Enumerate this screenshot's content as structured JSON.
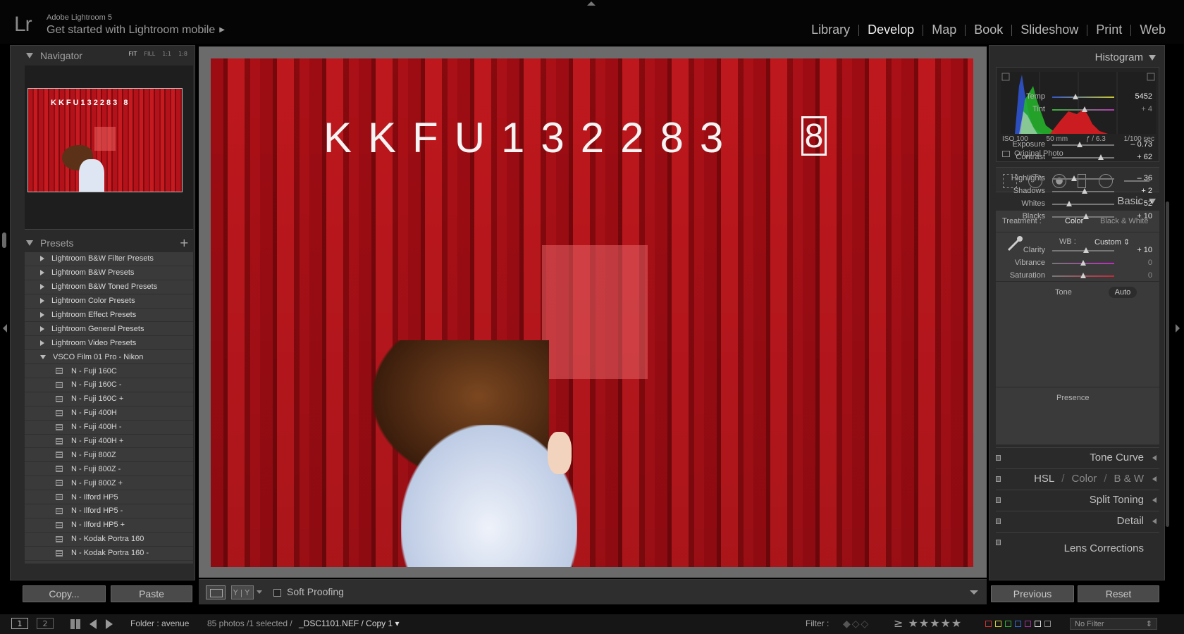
{
  "app": {
    "logo": "Lr",
    "version": "Adobe Lightroom 5",
    "mobile_link": "Get started with Lightroom mobile"
  },
  "modules": [
    {
      "label": "Library",
      "active": false
    },
    {
      "label": "Develop",
      "active": true
    },
    {
      "label": "Map",
      "active": false
    },
    {
      "label": "Book",
      "active": false
    },
    {
      "label": "Slideshow",
      "active": false
    },
    {
      "label": "Print",
      "active": false
    },
    {
      "label": "Web",
      "active": false
    }
  ],
  "navigator": {
    "title": "Navigator",
    "zoom_options": [
      "FIT",
      "FILL",
      "1:1",
      "1:8"
    ],
    "active_zoom": "FIT",
    "thumb_text": "KKFU132283 8"
  },
  "presets": {
    "title": "Presets",
    "add_icon": "plus-icon",
    "items": [
      {
        "label": "Lightroom B&W Filter Presets",
        "type": "folder"
      },
      {
        "label": "Lightroom B&W Presets",
        "type": "folder"
      },
      {
        "label": "Lightroom B&W Toned Presets",
        "type": "folder"
      },
      {
        "label": "Lightroom Color Presets",
        "type": "folder"
      },
      {
        "label": "Lightroom Effect Presets",
        "type": "folder"
      },
      {
        "label": "Lightroom General Presets",
        "type": "folder"
      },
      {
        "label": "Lightroom Video Presets",
        "type": "folder"
      },
      {
        "label": "VSCO Film 01 Pro - Nikon",
        "type": "folder-open"
      },
      {
        "label": "N - Fuji 160C",
        "type": "preset"
      },
      {
        "label": "N - Fuji 160C -",
        "type": "preset"
      },
      {
        "label": "N - Fuji 160C +",
        "type": "preset"
      },
      {
        "label": "N - Fuji 400H",
        "type": "preset"
      },
      {
        "label": "N - Fuji 400H -",
        "type": "preset"
      },
      {
        "label": "N - Fuji 400H +",
        "type": "preset"
      },
      {
        "label": "N - Fuji 800Z",
        "type": "preset"
      },
      {
        "label": "N - Fuji 800Z -",
        "type": "preset"
      },
      {
        "label": "N - Fuji 800Z +",
        "type": "preset"
      },
      {
        "label": "N - Ilford HP5",
        "type": "preset"
      },
      {
        "label": "N - Ilford HP5 -",
        "type": "preset"
      },
      {
        "label": "N - Ilford HP5 +",
        "type": "preset"
      },
      {
        "label": "N - Kodak Portra 160",
        "type": "preset"
      },
      {
        "label": "N - Kodak Portra 160 -",
        "type": "preset"
      },
      {
        "label": "N - Kodak Portra 160 +",
        "type": "preset"
      }
    ]
  },
  "left_buttons": {
    "copy": "Copy...",
    "paste": "Paste"
  },
  "photo": {
    "container_code": "KKFU132283",
    "container_check": "8"
  },
  "toolbar": {
    "soft_proofing": "Soft Proofing",
    "yy_label": "Y|Y"
  },
  "histogram": {
    "title": "Histogram",
    "iso": "ISO 100",
    "focal": "50 mm",
    "aperture": "ƒ / 6.3",
    "shutter": "1/100 sec",
    "original_photo": "Original Photo"
  },
  "basic": {
    "title": "Basic",
    "treatment_label": "Treatment :",
    "treatment_color": "Color",
    "treatment_bw": "Black & White",
    "wb_label": "WB :",
    "wb_value": "Custom",
    "tone_label": "Tone",
    "auto_label": "Auto",
    "presence_label": "Presence",
    "sliders": [
      {
        "label": "Temp",
        "value": "5452",
        "pos": 0.38,
        "dim": false
      },
      {
        "label": "Tint",
        "value": "+ 4",
        "pos": 0.52,
        "dim": true
      },
      {
        "label": "Exposure",
        "value": "– 0.73",
        "pos": 0.44,
        "dim": false
      },
      {
        "label": "Contrast",
        "value": "+ 62",
        "pos": 0.78,
        "dim": false
      },
      {
        "label": "Highlights",
        "value": "– 36",
        "pos": 0.35,
        "dim": false
      },
      {
        "label": "Shadows",
        "value": "+ 2",
        "pos": 0.52,
        "dim": false
      },
      {
        "label": "Whites",
        "value": "– 52",
        "pos": 0.27,
        "dim": false
      },
      {
        "label": "Blacks",
        "value": "+ 10",
        "pos": 0.55,
        "dim": false
      },
      {
        "label": "Clarity",
        "value": "+ 10",
        "pos": 0.55,
        "dim": false
      },
      {
        "label": "Vibrance",
        "value": "0",
        "pos": 0.5,
        "dim": true
      },
      {
        "label": "Saturation",
        "value": "0",
        "pos": 0.5,
        "dim": true
      }
    ]
  },
  "collapsed_panels": {
    "tone_curve": "Tone Curve",
    "hsl": "HSL",
    "color": "Color",
    "bw": "B & W",
    "split_toning": "Split Toning",
    "detail": "Detail",
    "lens": "Lens Corrections"
  },
  "right_buttons": {
    "previous": "Previous",
    "reset": "Reset"
  },
  "filmstrip": {
    "view1": "1",
    "view2": "2",
    "folder": "Folder : avenue",
    "count": "85 photos /1 selected /",
    "file": "_DSC1101.NEF / Copy 1",
    "filter_label": "Filter :",
    "rating_op": "≥",
    "stars": "★★★★★",
    "no_filter": "No Filter"
  },
  "colors": {
    "accent_red": "#b4121a",
    "label_colors": [
      "#c33",
      "#cc3",
      "#3a3",
      "#36c",
      "#939",
      "#ddd",
      "#888"
    ]
  }
}
